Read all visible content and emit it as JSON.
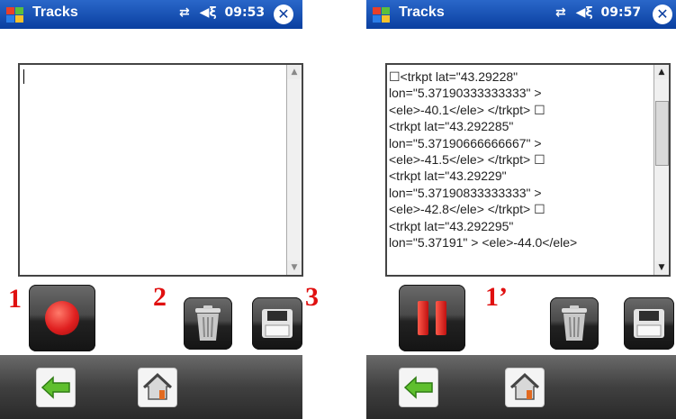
{
  "left_screen": {
    "app_title": "Tracks",
    "time": "09:53",
    "editor_content": "",
    "annotations": {
      "record": "1",
      "delete": "2",
      "save": "3"
    }
  },
  "right_screen": {
    "app_title": "Tracks",
    "time": "09:57",
    "editor_lines": [
      "☐<trkpt lat=\"43.29228\"",
      "lon=\"5.37190333333333\" >",
      "<ele>-40.1</ele> </trkpt> ☐",
      "<trkpt lat=\"43.292285\"",
      "lon=\"5.37190666666667\" >",
      "<ele>-41.5</ele> </trkpt> ☐",
      "<trkpt lat=\"43.29229\"",
      "lon=\"5.37190833333333\" >",
      "<ele>-42.8</ele> </trkpt> ☐",
      "<trkpt lat=\"43.292295\"",
      "lon=\"5.37191\" > <ele>-44.0</ele>"
    ],
    "annotations": {
      "pause": "1’"
    }
  },
  "icons": {
    "windows_logo": "windows-flag-icon",
    "connectivity": "connectivity-arrows-icon",
    "volume": "speaker-icon",
    "close": "close-icon",
    "record": "record-icon",
    "pause": "pause-icon",
    "delete": "trash-can-icon",
    "save": "floppy-disk-icon",
    "back": "back-arrow-icon",
    "home": "home-icon"
  },
  "colors": {
    "title_bar": "#0a3fa0",
    "record_red": "#e02020",
    "annotation_red": "#e01010",
    "bottom_bar": "#3a3a3a"
  }
}
